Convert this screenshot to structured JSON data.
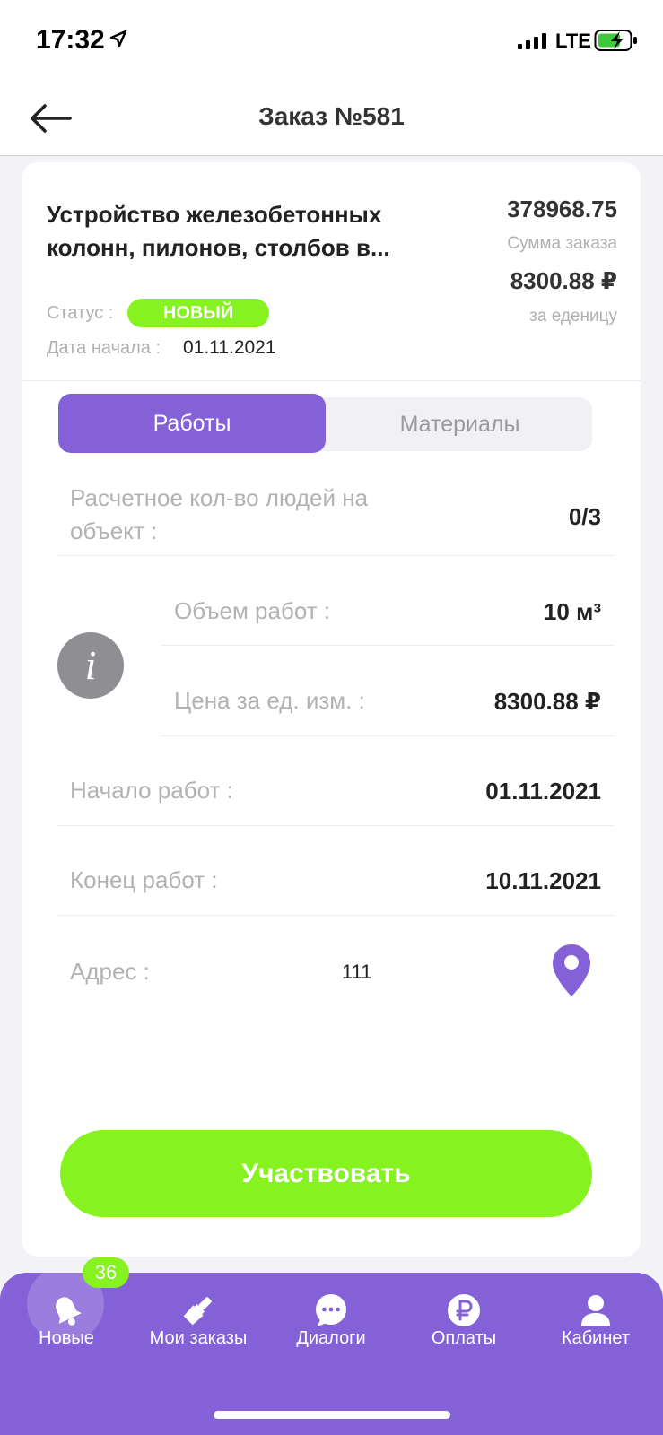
{
  "status_bar": {
    "time": "17:32",
    "network": "LTE"
  },
  "header": {
    "title": "Заказ №581",
    "back_icon": "arrow-left-icon"
  },
  "order": {
    "title": "Устройство железобетонных колонн, пилонов, столбов в...",
    "sum_value": "378968.75",
    "sum_label": "Сумма заказа",
    "unit_price": "8300.88 ₽",
    "unit_label": "за еденицу",
    "status_label": "Статус :",
    "status_value": "НОВЫЙ",
    "start_label": "Дата начала :",
    "start_value": "01.11.2021"
  },
  "tabs": [
    {
      "label": "Работы",
      "active": true
    },
    {
      "label": "Материалы",
      "active": false
    }
  ],
  "details": {
    "people_label": "Расчетное кол-во людей на объект :",
    "people_value": "0/3",
    "volume_label": "Объем работ :",
    "volume_value": "10 м³",
    "unit_price_label": "Цена за ед. изм. :",
    "unit_price_value": "8300.88 ₽",
    "start_label": "Начало работ :",
    "start_value": "01.11.2021",
    "end_label": "Конец работ :",
    "end_value": "10.11.2021",
    "address_label": "Адрес :",
    "address_value": "111",
    "info_icon": "i"
  },
  "participate_button": "Участвовать",
  "bottom_nav": [
    {
      "label": "Новые",
      "icon": "bell-icon",
      "badge": "36",
      "active": true
    },
    {
      "label": "Мои заказы",
      "icon": "brush-icon"
    },
    {
      "label": "Диалоги",
      "icon": "chat-icon"
    },
    {
      "label": "Оплаты",
      "icon": "ruble-icon"
    },
    {
      "label": "Кабинет",
      "icon": "user-icon"
    }
  ],
  "colors": {
    "accent": "#8461d6",
    "green": "#86f21f"
  }
}
